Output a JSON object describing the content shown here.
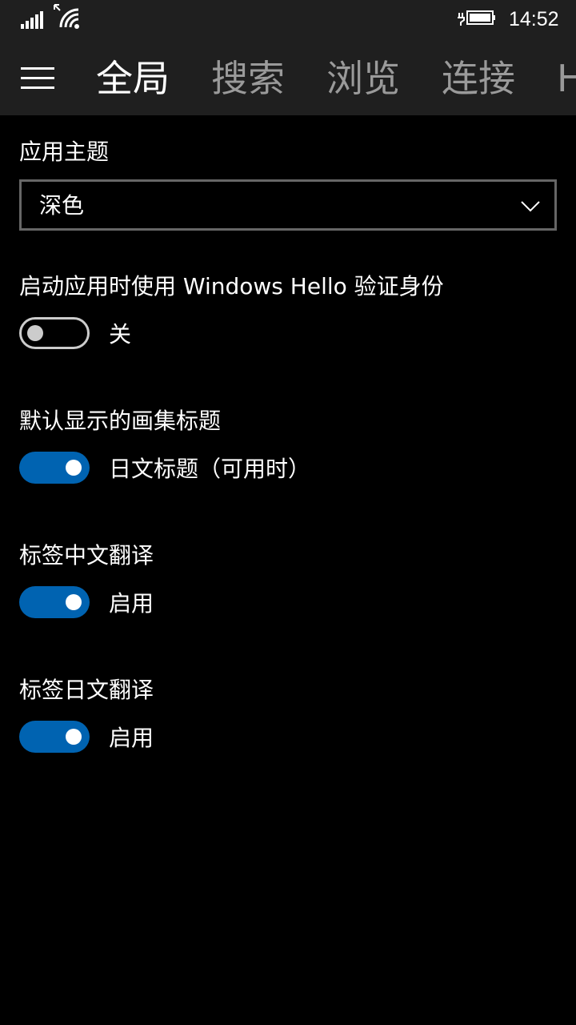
{
  "status_bar": {
    "time": "14:52",
    "icons": [
      "signal-strength-icon",
      "wifi-icon",
      "battery-charging-icon"
    ]
  },
  "header": {
    "menu_icon": "hamburger-menu-icon",
    "tabs": [
      {
        "label": "全局",
        "active": true
      },
      {
        "label": "搜索",
        "active": false
      },
      {
        "label": "浏览",
        "active": false
      },
      {
        "label": "连接",
        "active": false
      },
      {
        "label": "H",
        "active": false
      }
    ]
  },
  "settings": {
    "theme": {
      "label": "应用主题",
      "value": "深色",
      "icon": "chevron-down-icon"
    },
    "windows_hello": {
      "label": "启动应用时使用 Windows Hello 验证身份",
      "on": false,
      "state_text": "关"
    },
    "default_title": {
      "label": "默认显示的画集标题",
      "on": true,
      "state_text": "日文标题（可用时）"
    },
    "tag_chinese": {
      "label": "标签中文翻译",
      "on": true,
      "state_text": "启用"
    },
    "tag_japanese": {
      "label": "标签日文翻译",
      "on": true,
      "state_text": "启用"
    }
  },
  "colors": {
    "accent": "#0063b1",
    "header_bg": "#1f1f1f",
    "background": "#000000",
    "inactive_tab": "#9a9a9a"
  }
}
